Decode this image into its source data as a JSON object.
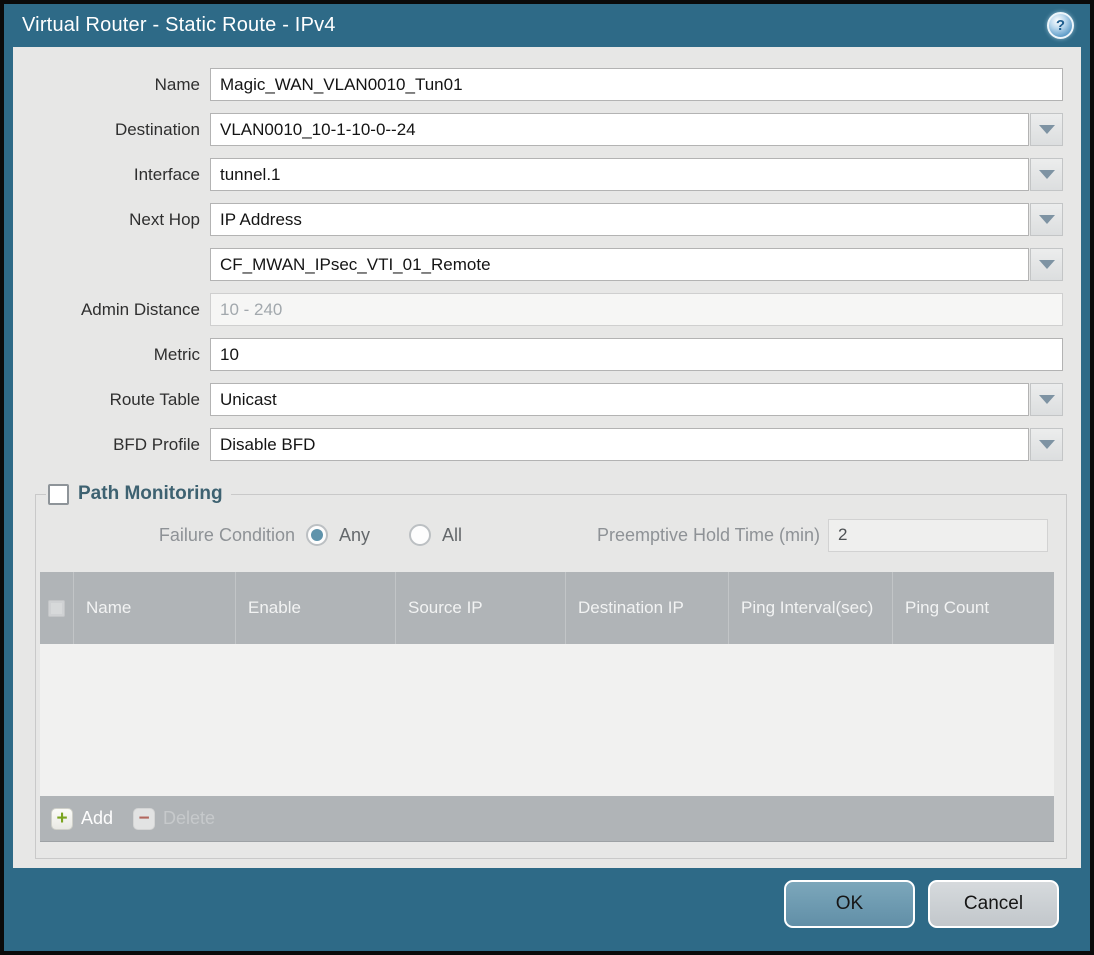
{
  "window": {
    "title": "Virtual Router - Static Route - IPv4",
    "help_icon": "?"
  },
  "colors": {
    "titlebar_teal": "#2e6a87",
    "body_gray": "#e7e7e6",
    "table_header_gray": "#b0b4b7",
    "ok_button": "#6c9db4",
    "cancel_button": "#ccd1d5",
    "add_plus_green": "#7aa41f",
    "delete_minus_red": "#b2675e",
    "radio_selected": "#5f93ab",
    "pm_title_color": "#3e6271"
  },
  "form": {
    "rows": [
      {
        "label": "Name",
        "value": "Magic_WAN_VLAN0010_Tun01"
      },
      {
        "label": "Destination",
        "value": "VLAN0010_10-1-10-0--24"
      },
      {
        "label": "Interface",
        "value": "tunnel.1"
      },
      {
        "label": "Next Hop",
        "value": "IP Address"
      },
      {
        "label": "",
        "value": "CF_MWAN_IPsec_VTI_01_Remote"
      },
      {
        "label": "Admin Distance",
        "placeholder": "10 - 240"
      },
      {
        "label": "Metric",
        "value": "10"
      },
      {
        "label": "Route Table",
        "value": "Unicast"
      },
      {
        "label": "BFD Profile",
        "value": "Disable BFD"
      }
    ]
  },
  "path_monitoring": {
    "title": "Path Monitoring",
    "failure_condition_label": "Failure Condition",
    "radio_any_label": "Any",
    "radio_any_selected": true,
    "radio_all_label": "All",
    "radio_all_selected": false,
    "preemptive_hold_label": "Preemptive Hold Time (min)",
    "preemptive_hold_value": "2",
    "table": {
      "columns": [
        "Name",
        "Enable",
        "Source IP",
        "Destination IP",
        "Ping Interval(sec)",
        "Ping Count"
      ],
      "rows": []
    },
    "add_label": "Add",
    "delete_label": "Delete"
  },
  "footer": {
    "ok_label": "OK",
    "cancel_label": "Cancel"
  }
}
